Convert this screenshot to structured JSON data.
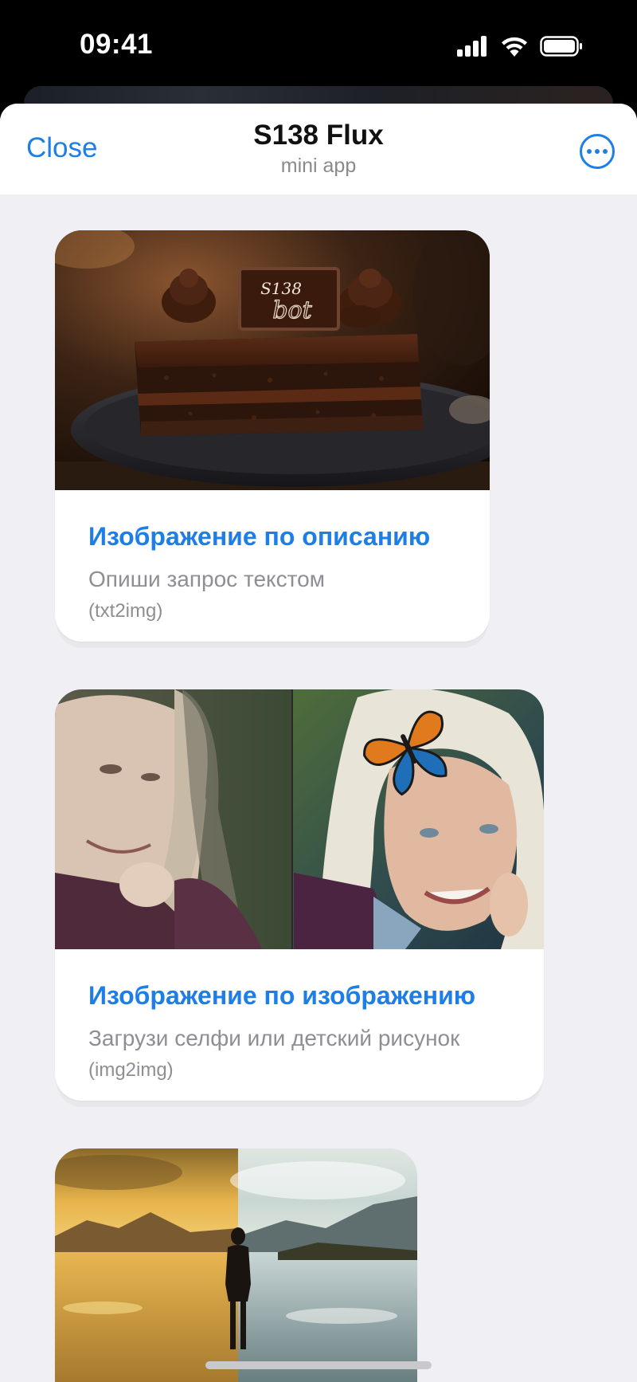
{
  "status_bar": {
    "time": "09:41"
  },
  "header": {
    "close_label": "Close",
    "title": "S138 Flux",
    "subtitle": "mini app"
  },
  "cards": [
    {
      "title": "Изображение по описанию",
      "description": "Опиши запрос текстом",
      "tag": "(txt2img)",
      "image_text_top": "S138",
      "image_text_bottom": "bot"
    },
    {
      "title": "Изображение по изображению",
      "description": "Загрузи селфи или детский рисунок",
      "tag": "(img2img)"
    },
    {
      "title": "",
      "description": "",
      "tag": ""
    }
  ],
  "colors": {
    "accent": "#1d7ee8",
    "sheet_background": "#efeff4",
    "muted_text": "#8e8e93"
  }
}
